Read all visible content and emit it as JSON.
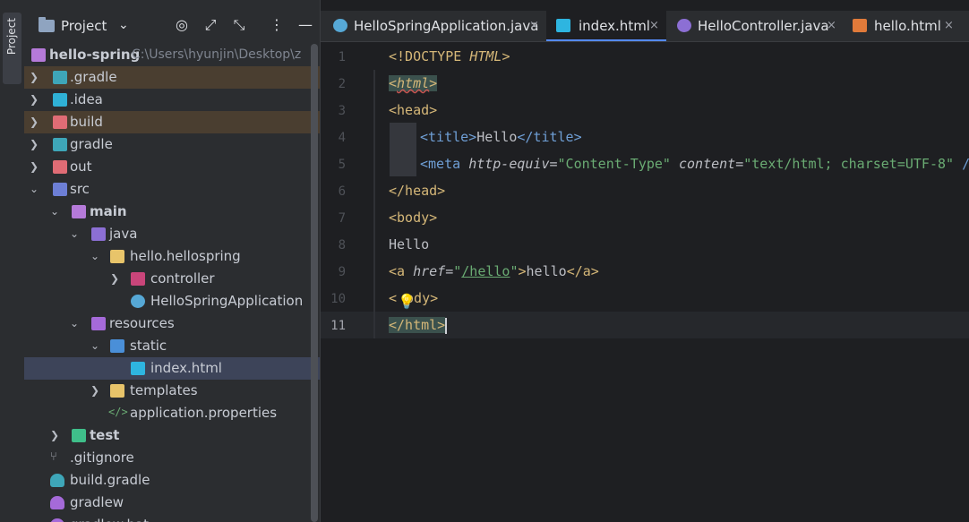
{
  "tool_strip": {
    "project_tab_label": "Project"
  },
  "panel": {
    "title": "Project",
    "dropdown_glyph": "⌄",
    "toolbar_icons": [
      "target-icon",
      "expand-icon",
      "collapse-icon",
      "more-icon",
      "minimize-icon"
    ]
  },
  "tree": [
    {
      "label": "hello-spring",
      "sub": "C:\\Users\\hyunjin\\Desktop\\z",
      "bold": true,
      "icon": "module-folder-icon"
    },
    {
      "label": ".gradle",
      "icon": "gradle-folder-icon"
    },
    {
      "label": ".idea",
      "icon": "idea-folder-icon"
    },
    {
      "label": "build",
      "icon": "excluded-folder-icon"
    },
    {
      "label": "gradle",
      "icon": "gradle-folder-icon"
    },
    {
      "label": "out",
      "icon": "excluded-folder-icon"
    },
    {
      "label": "src",
      "icon": "source-folder-icon"
    },
    {
      "label": "main",
      "bold": true,
      "icon": "module-folder-icon"
    },
    {
      "label": "java",
      "icon": "java-source-folder-icon"
    },
    {
      "label": "hello.hellospring",
      "icon": "package-icon"
    },
    {
      "label": "controller",
      "icon": "controller-package-icon"
    },
    {
      "label": "HelloSpringApplication",
      "icon": "spring-boot-class-icon"
    },
    {
      "label": "resources",
      "icon": "resources-folder-icon"
    },
    {
      "label": "static",
      "icon": "web-folder-icon"
    },
    {
      "label": "index.html",
      "icon": "html-file-icon"
    },
    {
      "label": "templates",
      "icon": "templates-folder-icon"
    },
    {
      "label": "application.properties",
      "icon": "properties-file-icon"
    },
    {
      "label": "test",
      "bold": true,
      "icon": "test-folder-icon"
    },
    {
      "label": ".gitignore",
      "icon": "git-file-icon"
    },
    {
      "label": "build.gradle",
      "icon": "gradle-file-icon"
    },
    {
      "label": "gradlew",
      "icon": "gradle-file-icon"
    },
    {
      "label": "gradlew.bat",
      "icon": "gradle-file-icon"
    }
  ],
  "tabs": [
    {
      "label": "HelloSpringApplication.java",
      "icon": "spring-boot-class-icon"
    },
    {
      "label": "index.html",
      "icon": "html-file-icon"
    },
    {
      "label": "HelloController.java",
      "icon": "java-class-icon"
    },
    {
      "label": "hello.html",
      "icon": "html5-file-icon"
    }
  ],
  "tab_close_glyph": "×",
  "line_numbers": [
    "1",
    "2",
    "3",
    "4",
    "5",
    "6",
    "7",
    "8",
    "9",
    "10",
    "11"
  ],
  "code": {
    "l1": {
      "tag_open": "<!DOCTYPE ",
      "doctype": "HTML",
      "tag_close": ">"
    },
    "l2": {
      "lt": "<",
      "name": "html",
      "gt": ">"
    },
    "l3": {
      "text": "<head>"
    },
    "l4": {
      "open": "<title>",
      "text": "Hello",
      "close": "</title>"
    },
    "l5": {
      "open": "<meta ",
      "attr1": "http-equiv",
      "eq1": "=",
      "val1": "\"Content-Type\"",
      "sp": " ",
      "attr2": "content",
      "eq2": "=",
      "val2": "\"text/html; charset=UTF-8\"",
      "end": " /"
    },
    "l6": {
      "text": "</head>"
    },
    "l7": {
      "text": "<body>"
    },
    "l8": {
      "text": "Hello"
    },
    "l9": {
      "open": "<a ",
      "attr": "href",
      "eq": "=",
      "q1": "\"",
      "val": "/hello",
      "q2": "\"",
      "gt": ">",
      "text": "hello",
      "close": "</a>"
    },
    "l10": {
      "lt": "<",
      "rest": "ody>"
    },
    "l11": {
      "text": "</html>"
    }
  },
  "colors": {
    "accent": "#548af7",
    "tag": "#d5b778",
    "string": "#6aab73",
    "panel_bg": "#2b2d30",
    "editor_bg": "#1e1f22",
    "excluded_highlight": "#4a3e30",
    "selection": "#3d4459"
  }
}
